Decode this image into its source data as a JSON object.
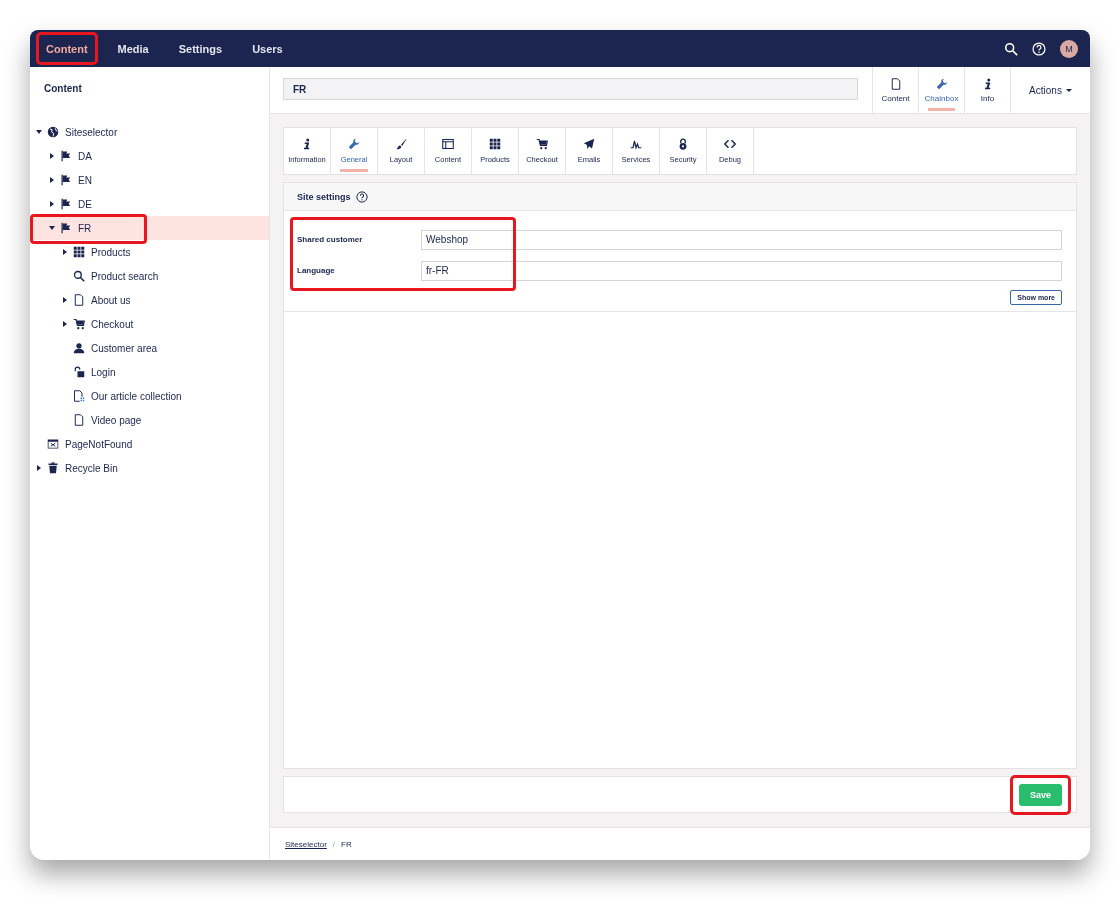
{
  "top_nav": {
    "items": [
      {
        "label": "Content",
        "selected": true,
        "highlighted": true
      },
      {
        "label": "Media",
        "selected": false,
        "highlighted": false
      },
      {
        "label": "Settings",
        "selected": false,
        "highlighted": false
      },
      {
        "label": "Users",
        "selected": false,
        "highlighted": false
      }
    ],
    "avatar": "M"
  },
  "sidebar": {
    "title": "Content",
    "tree": [
      {
        "label": "Siteselector",
        "kind": "globe",
        "expandable": true,
        "expanded": true,
        "selected": false,
        "highlighted": false,
        "children": [
          {
            "label": "DA",
            "kind": "flag",
            "expandable": true,
            "expanded": false,
            "selected": false,
            "highlighted": false
          },
          {
            "label": "EN",
            "kind": "flag",
            "expandable": true,
            "expanded": false,
            "selected": false,
            "highlighted": false
          },
          {
            "label": "DE",
            "kind": "flag",
            "expandable": true,
            "expanded": false,
            "selected": false,
            "highlighted": false
          },
          {
            "label": "FR",
            "kind": "flag",
            "expandable": true,
            "expanded": true,
            "selected": true,
            "highlighted": true,
            "children": [
              {
                "label": "Products",
                "kind": "grid",
                "expandable": true,
                "expanded": false,
                "selected": false,
                "highlighted": false
              },
              {
                "label": "Product search",
                "kind": "search",
                "expandable": false,
                "selected": false,
                "highlighted": false
              },
              {
                "label": "About us",
                "kind": "page",
                "expandable": true,
                "expanded": false,
                "selected": false,
                "highlighted": false
              },
              {
                "label": "Checkout",
                "kind": "cart",
                "expandable": true,
                "expanded": false,
                "selected": false,
                "highlighted": false
              },
              {
                "label": "Customer area",
                "kind": "user",
                "expandable": false,
                "selected": false,
                "highlighted": false
              },
              {
                "label": "Login",
                "kind": "lock",
                "expandable": false,
                "selected": false,
                "highlighted": false
              },
              {
                "label": "Our article collection",
                "kind": "collection",
                "expandable": false,
                "selected": false,
                "highlighted": false
              },
              {
                "label": "Video page",
                "kind": "page",
                "expandable": false,
                "selected": false,
                "highlighted": false
              }
            ]
          }
        ]
      },
      {
        "label": "PageNotFound",
        "kind": "notfound",
        "expandable": false,
        "selected": false,
        "highlighted": false
      },
      {
        "label": "Recycle Bin",
        "kind": "trash",
        "expandable": true,
        "expanded": false,
        "selected": false,
        "highlighted": false
      }
    ]
  },
  "editor": {
    "name": "FR",
    "app_tabs": [
      {
        "label": "Content",
        "kind": "page",
        "selected": false
      },
      {
        "label": "Chainbox",
        "kind": "wrench",
        "selected": true
      },
      {
        "label": "Info",
        "kind": "info",
        "selected": false
      }
    ],
    "actions": "Actions",
    "tabs": [
      {
        "label": "Information",
        "kind": "info",
        "selected": false
      },
      {
        "label": "General",
        "kind": "wrench",
        "selected": true
      },
      {
        "label": "Layout",
        "kind": "brush",
        "selected": false
      },
      {
        "label": "Content",
        "kind": "layout",
        "selected": false
      },
      {
        "label": "Products",
        "kind": "grid",
        "selected": false
      },
      {
        "label": "Checkout",
        "kind": "cart",
        "selected": false
      },
      {
        "label": "Emails",
        "kind": "plane",
        "selected": false
      },
      {
        "label": "Services",
        "kind": "pulse",
        "selected": false
      },
      {
        "label": "Security",
        "kind": "lock2",
        "selected": false
      },
      {
        "label": "Debug",
        "kind": "code",
        "selected": false
      }
    ],
    "settings": {
      "title": "Site settings",
      "highlighted": true,
      "fields": [
        {
          "label": "Shared customer",
          "value": "Webshop"
        },
        {
          "label": "Language",
          "value": "fr-FR"
        }
      ],
      "show_more": "Show more"
    },
    "save": {
      "label": "Save",
      "highlighted": true
    },
    "breadcrumb": [
      "Siteselector",
      "FR"
    ],
    "breadcrumb_separator": "/"
  }
}
